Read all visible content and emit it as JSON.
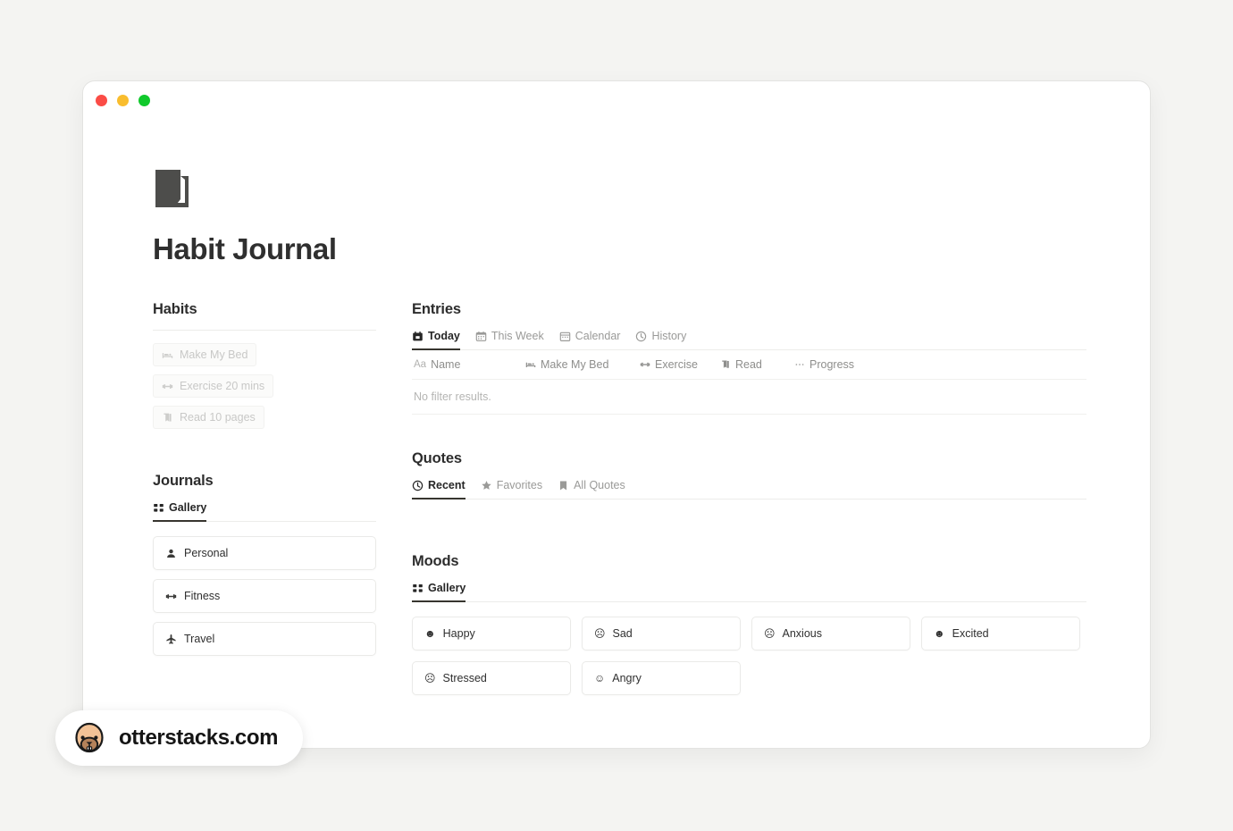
{
  "window": {
    "traffic_lights": [
      {
        "name": "close",
        "color": "#fb4c46"
      },
      {
        "name": "minimize",
        "color": "#f9bd2e"
      },
      {
        "name": "zoom",
        "color": "#10c92c"
      }
    ]
  },
  "page": {
    "icon": "notebook-icon",
    "title": "Habit Journal"
  },
  "habits": {
    "heading": "Habits",
    "items": [
      {
        "label": "Make My Bed",
        "icon": "bed-icon"
      },
      {
        "label": "Exercise 20 mins",
        "icon": "dumbbell-icon"
      },
      {
        "label": "Read 10 pages",
        "icon": "book-icon"
      }
    ]
  },
  "journals": {
    "heading": "Journals",
    "tabs": [
      {
        "label": "Gallery",
        "icon": "gallery-icon",
        "active": true
      }
    ],
    "cards": [
      {
        "label": "Personal",
        "icon": "person-icon"
      },
      {
        "label": "Fitness",
        "icon": "dumbbell-icon"
      },
      {
        "label": "Travel",
        "icon": "airplane-icon"
      }
    ]
  },
  "entries": {
    "heading": "Entries",
    "tabs": [
      {
        "label": "Today",
        "icon": "calendar-filled-icon",
        "active": true
      },
      {
        "label": "This Week",
        "icon": "calendar-days-icon",
        "active": false
      },
      {
        "label": "Calendar",
        "icon": "calendar-outline-icon",
        "active": false
      },
      {
        "label": "History",
        "icon": "clock-icon",
        "active": false
      }
    ],
    "table": {
      "columns": [
        {
          "label": "Name",
          "icon": "aa-text-icon"
        },
        {
          "label": "Make My Bed",
          "icon": "bed-icon"
        },
        {
          "label": "Exercise",
          "icon": "dumbbell-icon"
        },
        {
          "label": "Read",
          "icon": "book-icon"
        },
        {
          "label": "Progress",
          "icon": "ellipsis-icon"
        }
      ],
      "empty_message": "No filter results."
    }
  },
  "quotes": {
    "heading": "Quotes",
    "tabs": [
      {
        "label": "Recent",
        "icon": "clock-icon",
        "active": true
      },
      {
        "label": "Favorites",
        "icon": "star-icon",
        "active": false
      },
      {
        "label": "All Quotes",
        "icon": "bookmark-icon",
        "active": false
      }
    ]
  },
  "moods": {
    "heading": "Moods",
    "tabs": [
      {
        "label": "Gallery",
        "icon": "gallery-icon",
        "active": true
      }
    ],
    "cards": [
      {
        "label": "Happy",
        "icon": "smiley-happy-icon"
      },
      {
        "label": "Sad",
        "icon": "smiley-sad-icon"
      },
      {
        "label": "Anxious",
        "icon": "smiley-anxious-icon"
      },
      {
        "label": "Excited",
        "icon": "smiley-excited-icon"
      },
      {
        "label": "Stressed",
        "icon": "smiley-stressed-icon"
      },
      {
        "label": "Angry",
        "icon": "smiley-angry-icon"
      }
    ]
  },
  "watermark": {
    "text": "otterstacks.com",
    "icon": "otter-face-icon"
  }
}
